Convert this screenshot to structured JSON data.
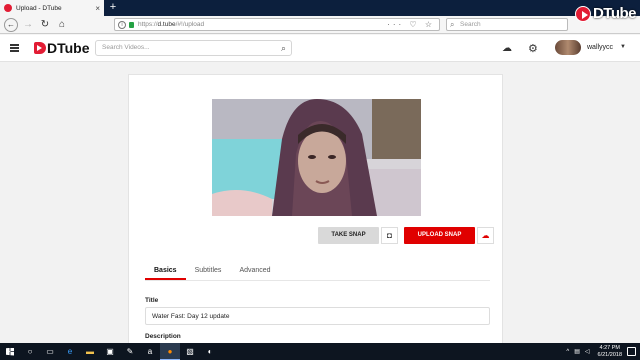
{
  "browser": {
    "tab_title": "Upload - DTube",
    "tab_close": "×",
    "new_tab": "+",
    "url_prefix": "https://",
    "url_host": "d.tube",
    "url_path": "/#!/upload",
    "url_actions": "··· ♡ ☆",
    "search_placeholder": "Search"
  },
  "watermark": {
    "text": "DTube"
  },
  "header": {
    "logo_text": "DTube",
    "search_placeholder": "Search Videos...",
    "username": "wallyycc"
  },
  "upload": {
    "take_snap_label": "TAKE SNAP",
    "upload_snap_label": "UPLOAD SNAP",
    "tabs": [
      {
        "label": "Basics",
        "active": true
      },
      {
        "label": "Subtitles",
        "active": false
      },
      {
        "label": "Advanced",
        "active": false
      }
    ],
    "title_label": "Title",
    "title_value": "Water Fast: Day 12 update",
    "description_label": "Description"
  },
  "taskbar": {
    "time": "4:27 PM",
    "date": "6/21/2018"
  },
  "colors": {
    "brand_red": "#e21c34",
    "button_red": "#e00000",
    "taskbar": "#0d1520"
  }
}
